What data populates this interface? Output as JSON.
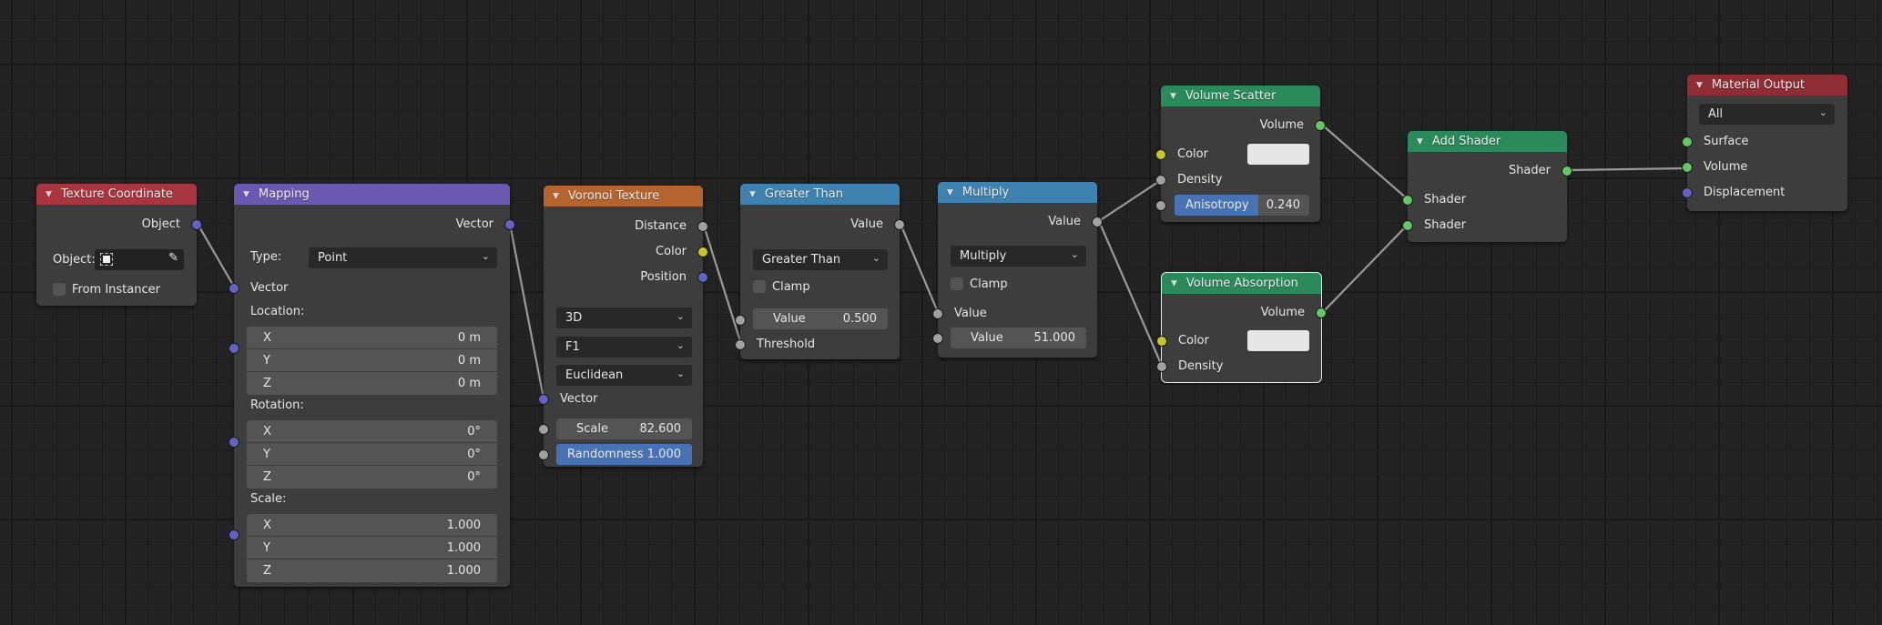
{
  "editor": "Shader Node Editor",
  "nodes": {
    "texture_coordinate": {
      "title": "Texture Coordinate",
      "header_color": "#a8353f",
      "outputs": [
        "Object"
      ],
      "object_label": "Object:",
      "from_instancer": "From Instancer"
    },
    "mapping": {
      "title": "Mapping",
      "header_color": "#6a59b0",
      "outputs": [
        "Vector"
      ],
      "type_label": "Type:",
      "type_value": "Point",
      "inputs": [
        "Vector"
      ],
      "location_label": "Location:",
      "location": [
        {
          "axis": "X",
          "value": "0 m"
        },
        {
          "axis": "Y",
          "value": "0 m"
        },
        {
          "axis": "Z",
          "value": "0 m"
        }
      ],
      "rotation_label": "Rotation:",
      "rotation": [
        {
          "axis": "X",
          "value": "0°"
        },
        {
          "axis": "Y",
          "value": "0°"
        },
        {
          "axis": "Z",
          "value": "0°"
        }
      ],
      "scale_label": "Scale:",
      "scale": [
        {
          "axis": "X",
          "value": "1.000"
        },
        {
          "axis": "Y",
          "value": "1.000"
        },
        {
          "axis": "Z",
          "value": "1.000"
        }
      ]
    },
    "voronoi": {
      "title": "Voronoi Texture",
      "header_color": "#b5642f",
      "outputs": [
        "Distance",
        "Color",
        "Position"
      ],
      "dimensions": "3D",
      "feature": "F1",
      "metric": "Euclidean",
      "vector_label": "Vector",
      "scale_label": "Scale",
      "scale_value": "82.600",
      "randomness_label": "Randomness",
      "randomness_value": "1.000"
    },
    "greater_than": {
      "title": "Greater Than",
      "header_color": "#3e82b0",
      "output": "Value",
      "operation": "Greater Than",
      "clamp": "Clamp",
      "value_label": "Value",
      "value": "0.500",
      "threshold_label": "Threshold"
    },
    "multiply": {
      "title": "Multiply",
      "header_color": "#3e82b0",
      "output": "Value",
      "operation": "Multiply",
      "clamp": "Clamp",
      "input1_label": "Value",
      "value_label": "Value",
      "value": "51.000"
    },
    "volume_scatter": {
      "title": "Volume Scatter",
      "header_color": "#2a8a5c",
      "output": "Volume",
      "color_label": "Color",
      "color_value": "#e6e6e6",
      "density_label": "Density",
      "anisotropy_label": "Anisotropy",
      "anisotropy_value": "0.240",
      "anisotropy_fraction": 0.62
    },
    "volume_absorption": {
      "title": "Volume Absorption",
      "header_color": "#2a8a5c",
      "output": "Volume",
      "color_label": "Color",
      "color_value": "#e6e6e6",
      "density_label": "Density",
      "selected": true
    },
    "add_shader": {
      "title": "Add Shader",
      "header_color": "#2a8a5c",
      "output": "Shader",
      "inputs": [
        "Shader",
        "Shader"
      ]
    },
    "material_output": {
      "title": "Material Output",
      "header_color": "#8f2d34",
      "target": "All",
      "inputs": [
        "Surface",
        "Volume",
        "Displacement"
      ]
    }
  },
  "links": [
    {
      "from": "texture_coordinate.Object",
      "to": "mapping.Vector"
    },
    {
      "from": "mapping.Vector",
      "to": "voronoi.Vector"
    },
    {
      "from": "voronoi.Distance",
      "to": "greater_than.Threshold"
    },
    {
      "from": "greater_than.Value",
      "to": "multiply.Value"
    },
    {
      "from": "multiply.Value",
      "to": "volume_scatter.Density"
    },
    {
      "from": "multiply.Value",
      "to": "volume_absorption.Density"
    },
    {
      "from": "volume_scatter.Volume",
      "to": "add_shader.Shader1"
    },
    {
      "from": "volume_absorption.Volume",
      "to": "add_shader.Shader2"
    },
    {
      "from": "add_shader.Shader",
      "to": "material_output.Volume"
    }
  ]
}
